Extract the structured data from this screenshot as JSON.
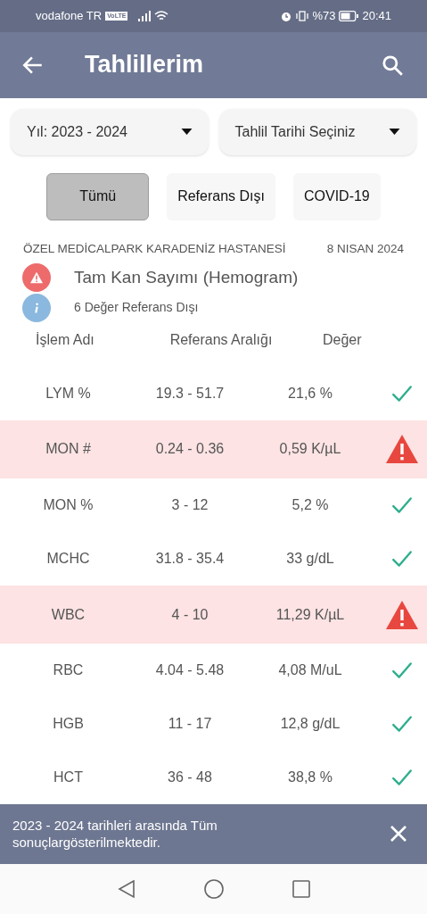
{
  "status_bar": {
    "carrier": "vodafone TR",
    "network_badge": "VoLTE",
    "battery": "%73",
    "time": "20:41"
  },
  "app_bar": {
    "title": "Tahlillerim"
  },
  "filters": [
    {
      "label": "Yıl: 2023 - 2024"
    },
    {
      "label": "Tahlil Tarihi Seçiniz"
    }
  ],
  "chips": [
    {
      "label": "Tümü",
      "selected": true
    },
    {
      "label": "Referans Dışı",
      "selected": false
    },
    {
      "label": "COVID-19",
      "selected": false
    }
  ],
  "report": {
    "hospital": "ÖZEL MEDİCALPARK KARADENİZ HASTANESİ",
    "date": "8 NISAN 2024",
    "test_name": "Tam Kan Sayımı (Hemogram)",
    "summary": "6 Değer Referans Dışı"
  },
  "table": {
    "columns": [
      "İşlem Adı",
      "Referans Aralığı",
      "Değer"
    ],
    "rows": [
      {
        "name": "LYM %",
        "range": "19.3 - 51.7",
        "value": "21,6 %",
        "out_of_range": false
      },
      {
        "name": "MON #",
        "range": "0.24 - 0.36",
        "value": "0,59 K/µL",
        "out_of_range": true
      },
      {
        "name": "MON %",
        "range": "3 - 12",
        "value": "5,2 %",
        "out_of_range": false
      },
      {
        "name": "MCHC",
        "range": "31.8 - 35.4",
        "value": "33 g/dL",
        "out_of_range": false
      },
      {
        "name": "WBC",
        "range": "4 - 10",
        "value": "11,29 K/µL",
        "out_of_range": true
      },
      {
        "name": "RBC",
        "range": "4.04 - 5.48",
        "value": "4,08 M/uL",
        "out_of_range": false
      },
      {
        "name": "HGB",
        "range": "11 - 17",
        "value": "12,8 g/dL",
        "out_of_range": false
      },
      {
        "name": "HCT",
        "range": "36 - 48",
        "value": "38,8 %",
        "out_of_range": false
      }
    ]
  },
  "snackbar": {
    "message": "2023 - 2024 tarihleri arasında Tüm sonuçlargösterilmektedir."
  }
}
